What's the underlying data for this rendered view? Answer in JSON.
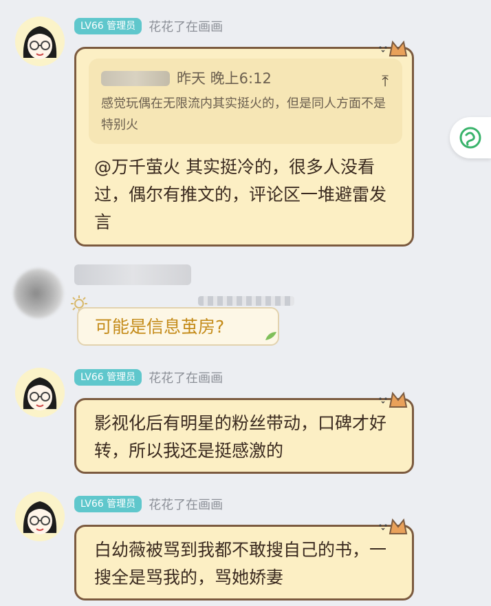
{
  "messages": [
    {
      "badge": "LV66 管理员",
      "nickname": "花花了在画画",
      "quote": {
        "time": "昨天 晚上6:12",
        "text": "感觉玩偶在无限流内其实挺火的，但是同人方面不是特别火",
        "jump_icon": "arrow-up-icon"
      },
      "text": "@万千萤火 其实挺冷的，很多人没看过，偶尔有推文的，评论区一堆避雷发言"
    },
    {
      "text": "可能是信息茧房?"
    },
    {
      "badge": "LV66 管理员",
      "nickname": "花花了在画画",
      "text": "影视化后有明星的粉丝带动，口碑才好转，所以我还是挺感激的"
    },
    {
      "badge": "LV66 管理员",
      "nickname": "花花了在画画",
      "text": "白幼薇被骂到我都不敢搜自己的书，一搜全是骂我的，骂她娇妻"
    }
  ],
  "colors": {
    "background": "#eceef2",
    "badge": "#5fc7cc",
    "bubble_fill": "#fcefc4",
    "bubble_border": "#7b5a3f",
    "plain_bubble_text": "#c48b19"
  },
  "side_button": {
    "icon": "app-logo-icon"
  }
}
